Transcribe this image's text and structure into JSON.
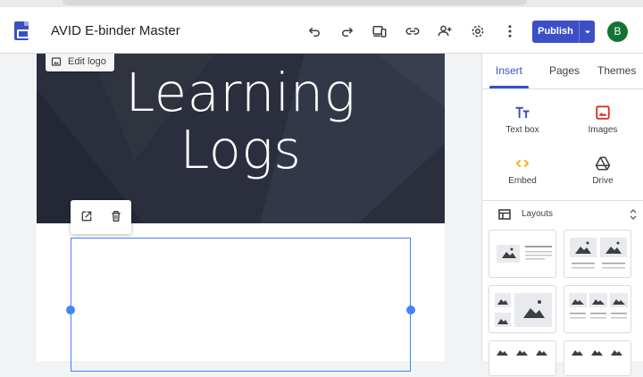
{
  "app": {
    "doc_title": "AVID E-binder Master",
    "icon": "google-sites-icon"
  },
  "toolbar": {
    "icons": [
      "undo-icon",
      "redo-icon",
      "preview-icon",
      "link-icon",
      "share-icon",
      "settings-icon",
      "more-vert-icon"
    ],
    "publish_label": "Publish",
    "avatar_letter": "B"
  },
  "page": {
    "hero_title": "Learning\nLogs",
    "edit_logo_label": "Edit logo"
  },
  "panel": {
    "tabs": [
      {
        "label": "Insert",
        "active": true
      },
      {
        "label": "Pages",
        "active": false
      },
      {
        "label": "Themes",
        "active": false
      }
    ],
    "tools": [
      {
        "label": "Text box",
        "icon": "text-box-icon"
      },
      {
        "label": "Images",
        "icon": "image-icon"
      },
      {
        "label": "Embed",
        "icon": "embed-code-icon"
      },
      {
        "label": "Drive",
        "icon": "drive-icon"
      }
    ],
    "layouts_label": "Layouts"
  },
  "colors": {
    "accent": "#3c4fc4",
    "hero_bg": "#2b2f3d",
    "selection": "#4285f4",
    "avatar": "#137333"
  }
}
